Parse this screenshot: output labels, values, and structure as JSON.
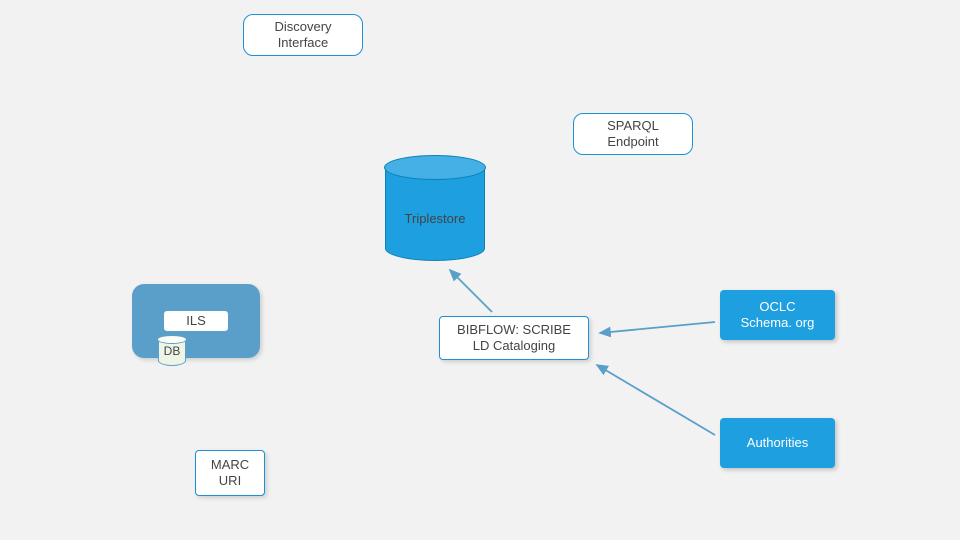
{
  "nodes": {
    "discovery": "Discovery\nInterface",
    "sparql": "SPARQL\nEndpoint",
    "triplestore": "Triplestore",
    "ils": "ILS",
    "db": "DB",
    "bibflow": "BIBFLOW: SCRIBE\nLD Cataloging",
    "oclc": "OCLC\nSchema. org",
    "authorities": "Authorities",
    "marc": "MARC\nURI"
  }
}
